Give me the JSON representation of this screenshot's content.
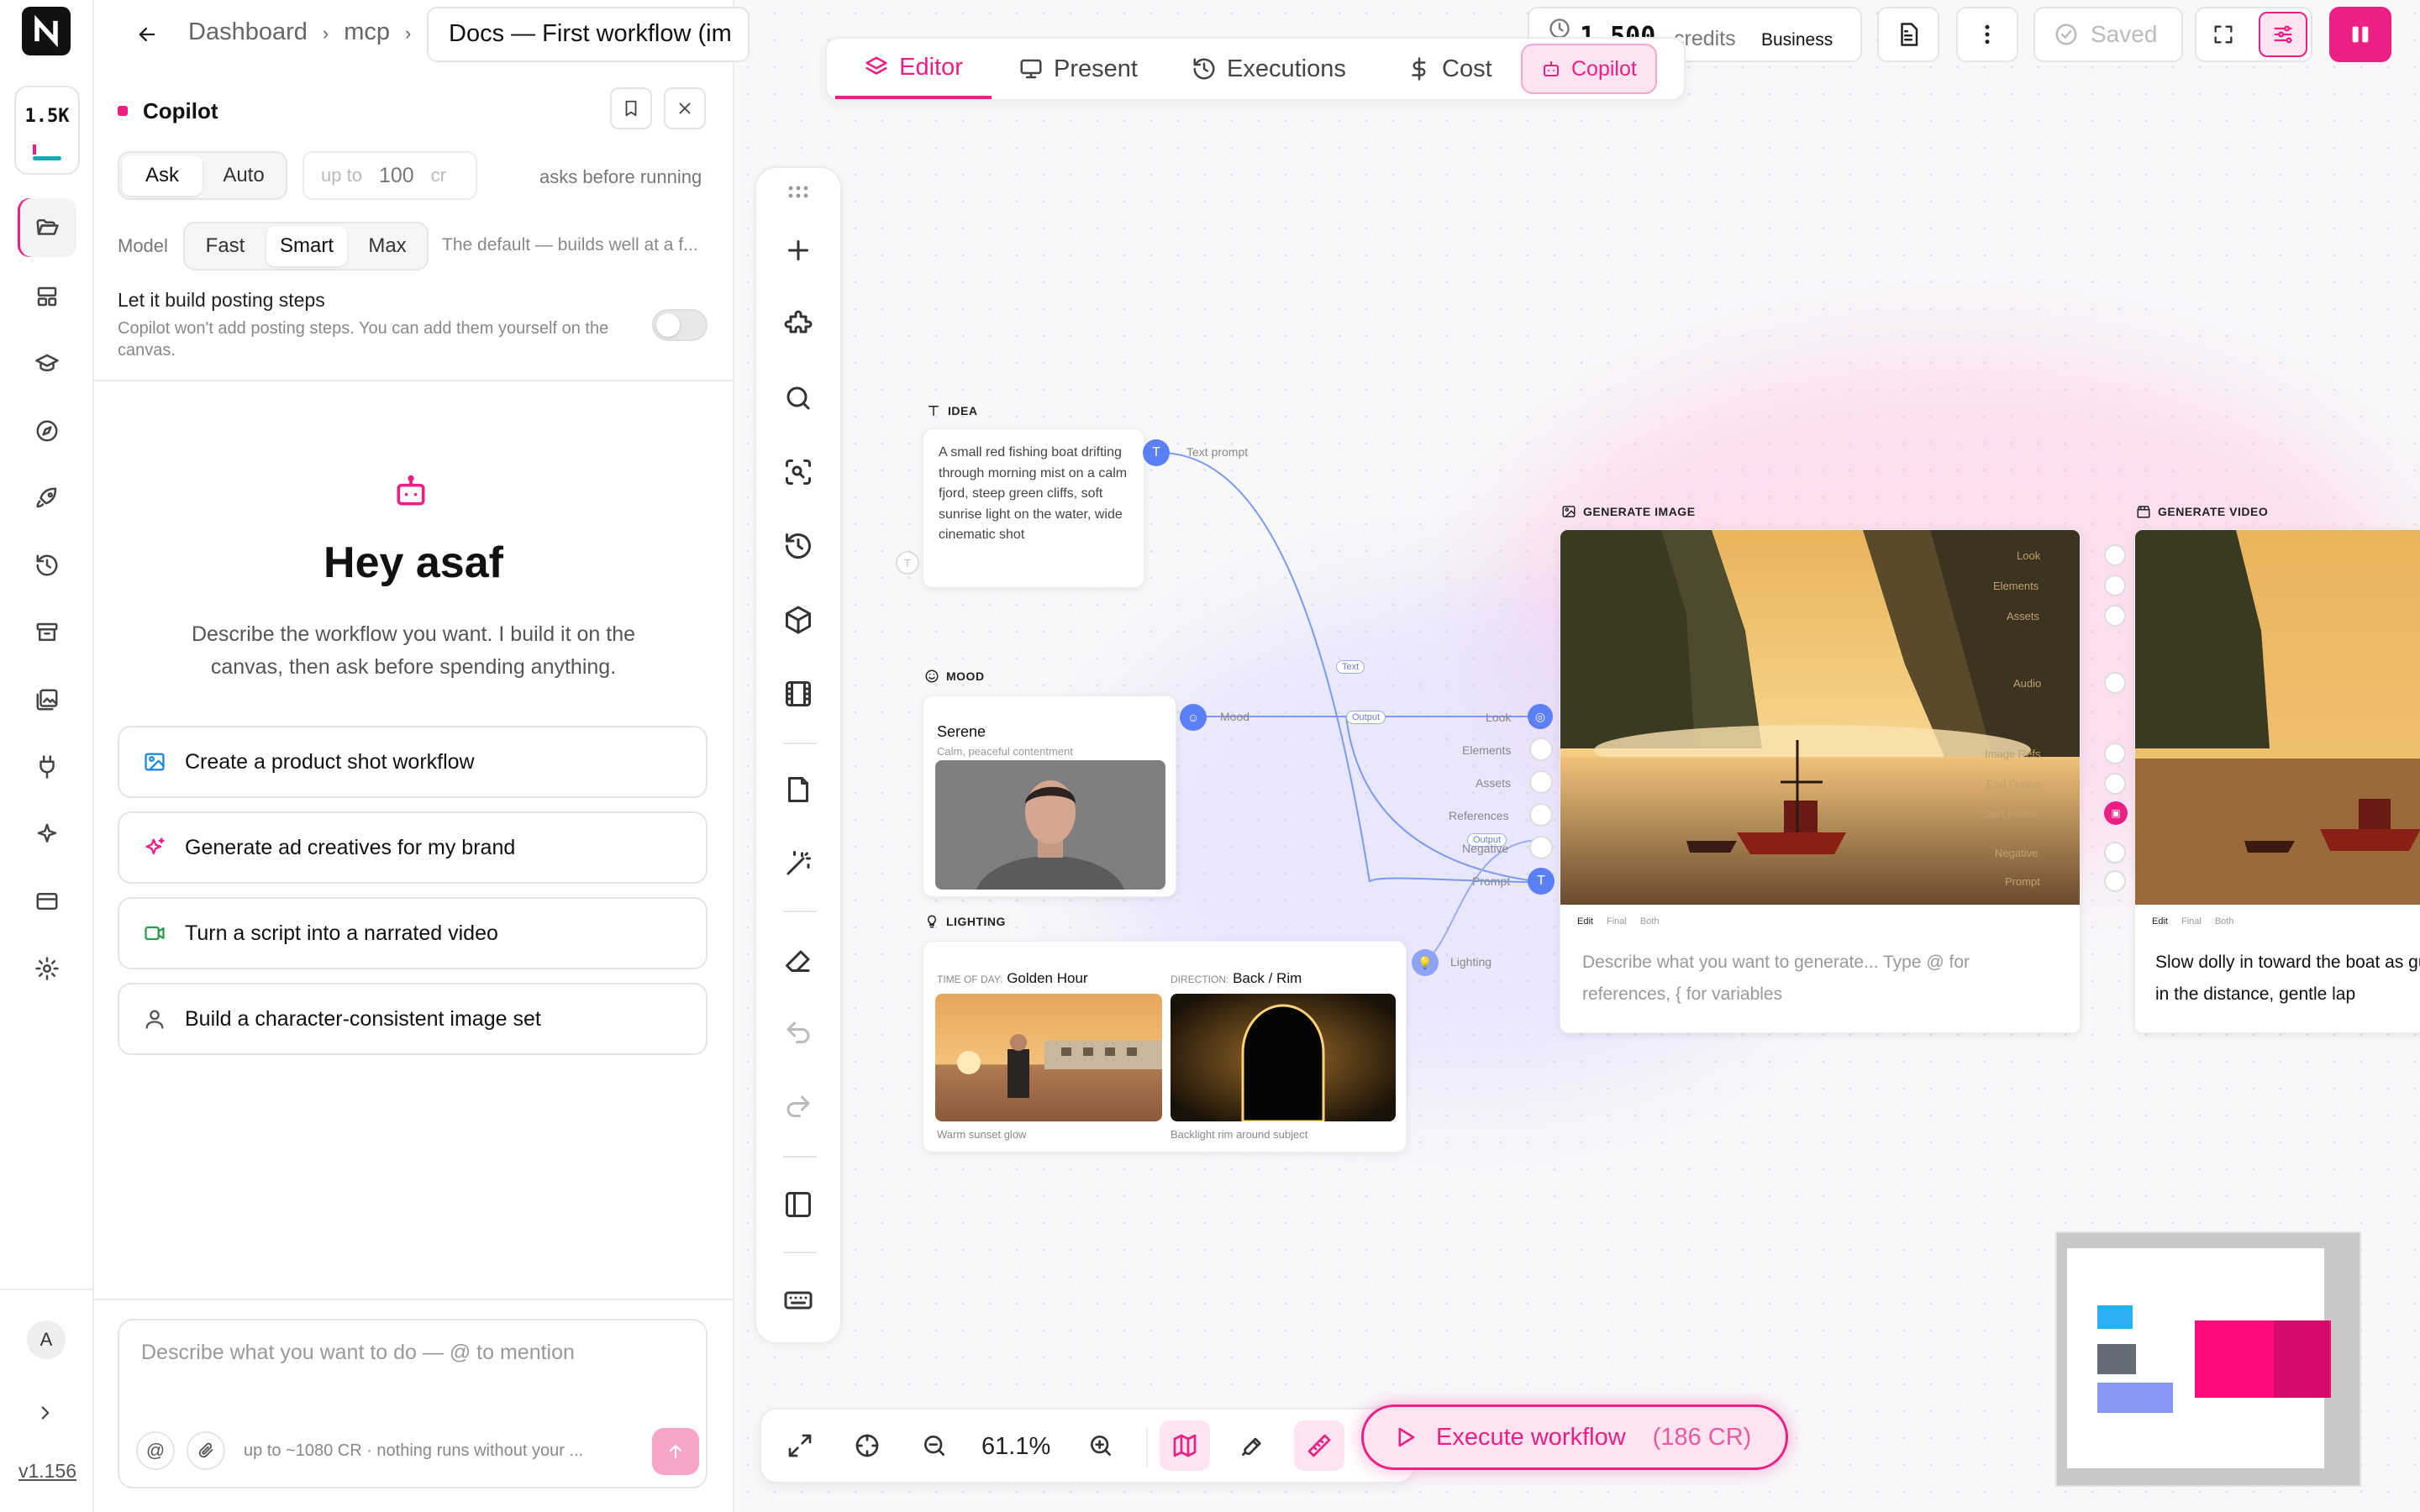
{
  "app": {
    "credits_badge": "1.5K",
    "version": "v1.156",
    "user_initial": "A"
  },
  "breadcrumb": {
    "items": [
      "Dashboard",
      "mcp"
    ],
    "doc_title": "Docs — First workflow (im"
  },
  "header": {
    "credits_value": "1,500",
    "credits_label": "credits",
    "plan": "Business",
    "saved_label": "Saved"
  },
  "tabs": [
    {
      "label": "Editor",
      "icon": "layers-icon",
      "active": true
    },
    {
      "label": "Present",
      "icon": "monitor-icon",
      "active": false
    },
    {
      "label": "Executions",
      "icon": "history-icon",
      "active": false
    },
    {
      "label": "Cost",
      "icon": "dollar-icon",
      "active": false
    },
    {
      "label": "Copilot",
      "icon": "bot-icon",
      "active": true
    }
  ],
  "copilot": {
    "title": "Copilot",
    "mode_options": [
      "Ask",
      "Auto"
    ],
    "mode_selected": "Ask",
    "budget_prefix": "up to",
    "budget_value": "100",
    "budget_unit": "cr",
    "mode_hint": "asks before running",
    "model_label": "Model",
    "model_options": [
      "Fast",
      "Smart",
      "Max"
    ],
    "model_selected": "Smart",
    "model_hint": "The default — builds well at a f...",
    "posting_title": "Let it build posting steps",
    "posting_desc": "Copilot won't add posting steps. You can add them yourself on the canvas.",
    "greeting": "Hey asaf",
    "intro": "Describe the workflow you want. I build it on the canvas, then ask before spending anything.",
    "suggestions": [
      {
        "label": "Create a product shot workflow",
        "icon": "image-icon"
      },
      {
        "label": "Generate ad creatives for my brand",
        "icon": "sparkles-icon"
      },
      {
        "label": "Turn a script into a narrated video",
        "icon": "video-icon"
      },
      {
        "label": "Build a character-consistent image set",
        "icon": "user-icon"
      }
    ],
    "composer_placeholder": "Describe what you want to do — @ to mention",
    "composer_footer": "up to ~1080 CR · nothing runs without your ..."
  },
  "nodes": {
    "idea": {
      "label": "IDEA",
      "text": "A small red fishing boat drifting through morning mist on a calm fjord, steep green cliffs, soft sunrise light on the water, wide cinematic shot",
      "port": "Text prompt"
    },
    "mood": {
      "label": "MOOD",
      "value": "Serene",
      "desc": "Calm, peaceful contentment",
      "port": "Mood"
    },
    "lighting": {
      "label": "LIGHTING",
      "time_label": "TIME OF DAY:",
      "time_value": "Golden Hour",
      "time_caption": "Warm sunset glow",
      "dir_label": "DIRECTION:",
      "dir_value": "Back / Rim",
      "dir_caption": "Backlight rim around subject",
      "port": "Lighting"
    },
    "generate_image": {
      "label": "GENERATE IMAGE",
      "inputs": [
        "Look",
        "Elements",
        "Assets",
        "References",
        "Negative",
        "Prompt"
      ],
      "edit_tabs": [
        "Edit",
        "Final",
        "Both"
      ],
      "prompt_placeholder": "Describe what you want to generate... Type @ for references, { for variables"
    },
    "generate_video": {
      "label": "GENERATE VIDEO",
      "inputs": [
        "Look",
        "Elements",
        "Assets",
        "Audio",
        "Image Refs",
        "End Frame",
        "Start Frame",
        "Negative",
        "Prompt"
      ],
      "edit_tabs": [
        "Edit",
        "Final",
        "Both"
      ],
      "prompt_text": "Slow dolly in toward the boat as gulls in the distance, gentle lap"
    },
    "edge_tags": [
      "Text",
      "Output",
      "Output"
    ]
  },
  "bottom_bar": {
    "zoom": "61.1%",
    "execute_label": "Execute workflow",
    "execute_cost": "(186 CR)"
  },
  "colors": {
    "accent": "#ec1f84",
    "node_blue": "#5b7ff5",
    "minimap_pink": "#ff0a7a"
  }
}
